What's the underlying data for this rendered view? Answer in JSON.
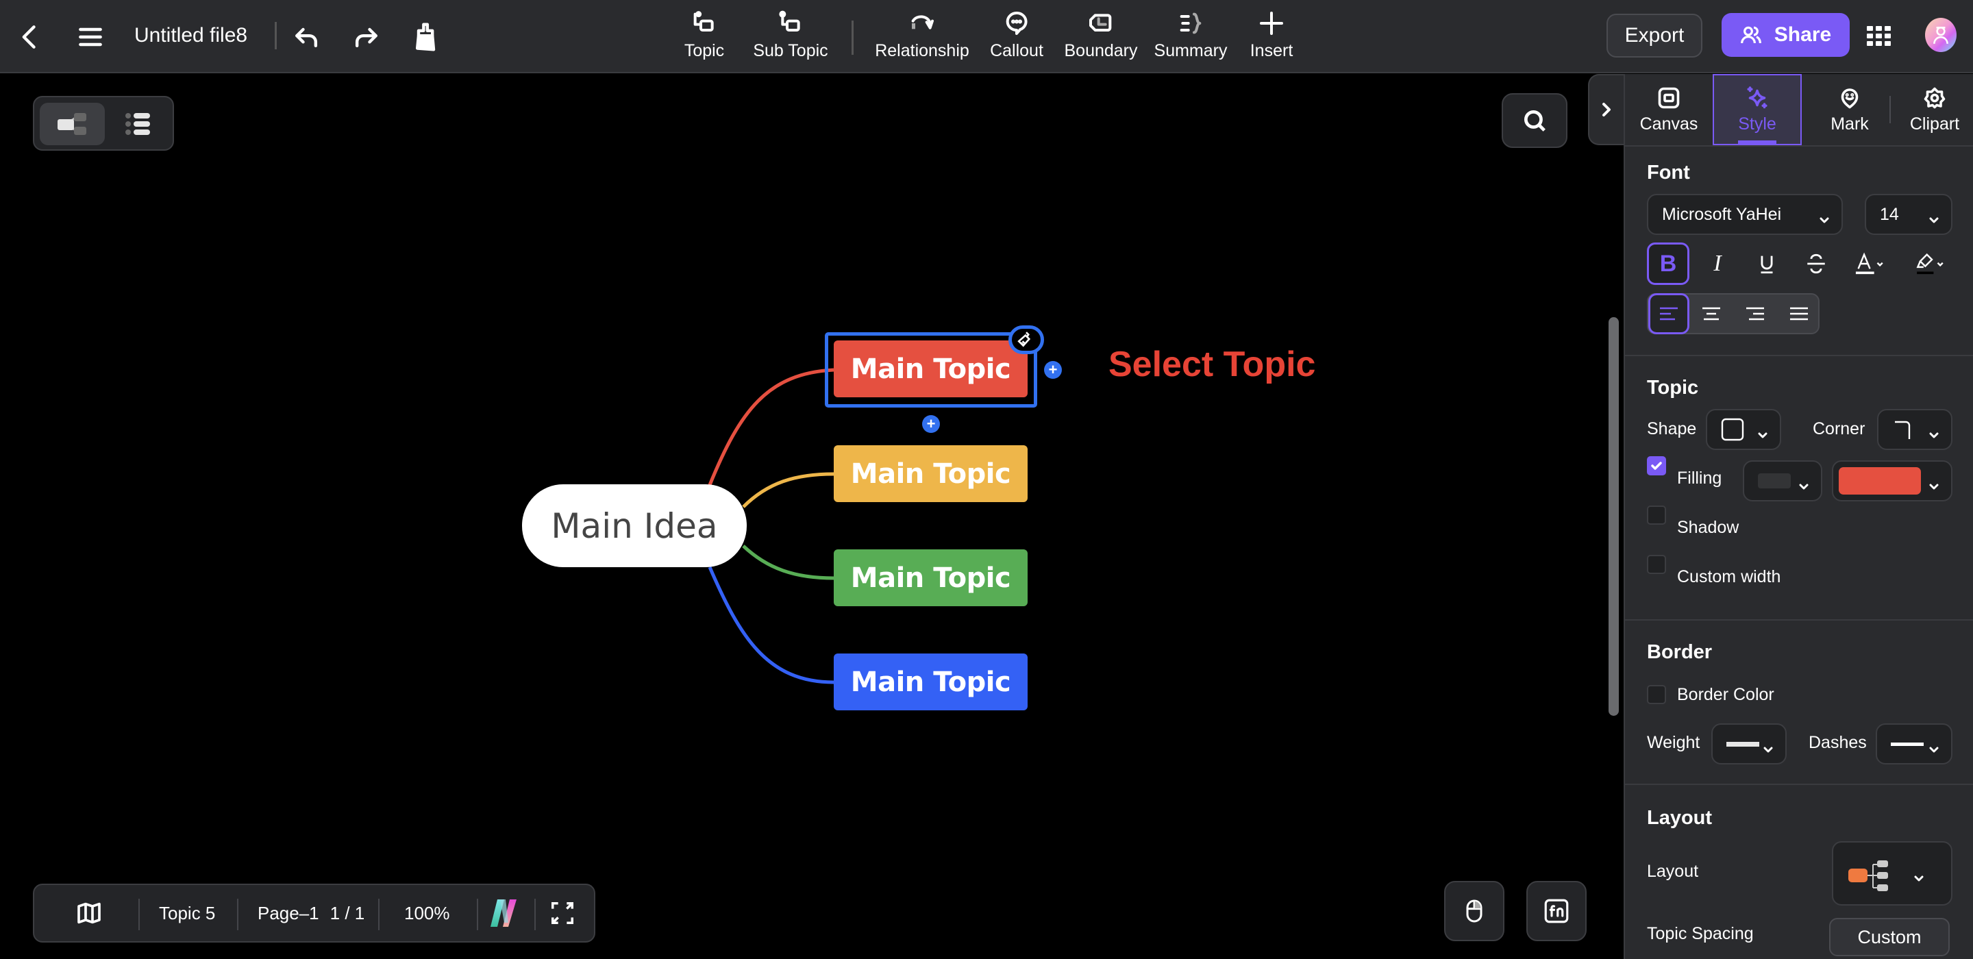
{
  "topbar": {
    "file_title": "Untitled file8",
    "tools": [
      {
        "label": "Topic",
        "icon": "topic-icon"
      },
      {
        "label": "Sub Topic",
        "icon": "subtopic-icon"
      },
      {
        "label": "Relationship",
        "icon": "relationship-icon"
      },
      {
        "label": "Callout",
        "icon": "callout-icon"
      },
      {
        "label": "Boundary",
        "icon": "boundary-icon"
      },
      {
        "label": "Summary",
        "icon": "summary-icon"
      },
      {
        "label": "Insert",
        "icon": "plus-icon"
      }
    ],
    "export_label": "Export",
    "share_label": "Share"
  },
  "canvas": {
    "main_idea": "Main Idea",
    "topics": [
      {
        "label": "Main Topic",
        "color": "#e55040",
        "selected": true
      },
      {
        "label": "Main Topic",
        "color": "#eeb64a",
        "selected": false
      },
      {
        "label": "Main Topic",
        "color": "#58ad55",
        "selected": false
      },
      {
        "label": "Main Topic",
        "color": "#3461f5",
        "selected": false
      }
    ],
    "annotation": "Select Topic",
    "annotation_color": "#e74436",
    "selection_color": "#3271f0"
  },
  "statusbar": {
    "topic_count": "Topic 5",
    "page_name": "Page–1",
    "page_index": "1 / 1",
    "zoom": "100%"
  },
  "panel": {
    "tabs": [
      {
        "label": "Canvas",
        "active": false
      },
      {
        "label": "Style",
        "active": true
      },
      {
        "label": "Mark",
        "active": false
      },
      {
        "label": "Clipart",
        "active": false
      }
    ],
    "font": {
      "title": "Font",
      "family": "Microsoft YaHei",
      "size": "14",
      "bold_label": "B",
      "italic_label": "I",
      "underline_label": "U",
      "bold_active": true,
      "align_active": "left"
    },
    "topic": {
      "title": "Topic",
      "shape_label": "Shape",
      "corner_label": "Corner",
      "filling_label": "Filling",
      "filling_checked": true,
      "fill_color": "#e55040",
      "shadow_label": "Shadow",
      "shadow_checked": false,
      "custom_width_label": "Custom width",
      "custom_width_checked": false
    },
    "border": {
      "title": "Border",
      "border_color_label": "Border Color",
      "border_color_checked": false,
      "weight_label": "Weight",
      "dashes_label": "Dashes"
    },
    "layout": {
      "title": "Layout",
      "layout_label": "Layout",
      "spacing_label": "Topic Spacing",
      "spacing_value": "Custom"
    }
  },
  "colors": {
    "accent": "#7a5af5",
    "topbar_bg": "#2a2b2e",
    "canvas_bg": "#000000"
  }
}
